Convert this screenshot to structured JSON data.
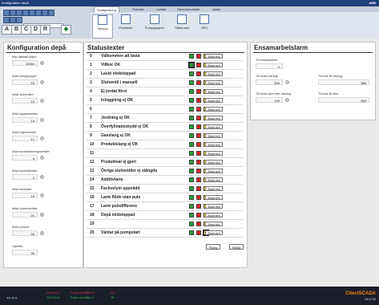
{
  "window": {
    "title": "Konfiguration depå",
    "brand_a": "Citect",
    "brand_b": "SCADA"
  },
  "toolbar": {
    "combo_value": "Bus",
    "letters": [
      "A",
      "B",
      "C",
      "D",
      "R"
    ]
  },
  "tabs": [
    "Konfigurering",
    "Översikt",
    "Loddar",
    "Huvudprodukter",
    "Adder"
  ],
  "ribbon_buttons": [
    "Service",
    "Produkter",
    "Pumpgrupper",
    "Tidkanaler",
    "VRU"
  ],
  "config": {
    "title": "Konfiguration depå",
    "fields": [
      {
        "label": "Max lastställ-volym:",
        "value": "10000"
      },
      {
        "label": "Antal pumpgrupper:",
        "value": "15"
      },
      {
        "label": "Antal slutventiler:",
        "value": "18"
      },
      {
        "label": "Antal bypassventiler:",
        "value": "14"
      },
      {
        "label": "Antal reglerventiler:",
        "value": "17"
      },
      {
        "label": "Antal tryckavlastningsventiler:",
        "value": "0"
      },
      {
        "label": "Antal tryckvisterster:",
        "value": "4"
      },
      {
        "label": "Antal trecrisare:",
        "value": "15"
      },
      {
        "label": "Antal ovlarmventiler:",
        "value": "20"
      },
      {
        "label": "Antal pumpar:",
        "value": "30"
      },
      {
        "label": "Cykeltid:",
        "value": "35"
      }
    ]
  },
  "status": {
    "title": "Statustexter",
    "edit_label": "Ändra text",
    "rows": [
      {
        "n": "0",
        "text": "Välkommen att lasta",
        "colors": [
          "g",
          "r",
          "y",
          "b"
        ],
        "sel": -1
      },
      {
        "n": "1",
        "text": "Villkor OK",
        "colors": [
          "g",
          "r",
          "y",
          "b"
        ],
        "sel": 0
      },
      {
        "n": "2",
        "text": "Lastö nödstoppad",
        "colors": [
          "g",
          "r",
          "y",
          "b"
        ],
        "sel": -1
      },
      {
        "n": "3",
        "text": "Slutventil i manuell",
        "colors": [
          "g",
          "r",
          "y",
          "b"
        ],
        "sel": -1
      },
      {
        "n": "4",
        "text": "Ej jordat först",
        "colors": [
          "g",
          "r",
          "y",
          "b"
        ],
        "sel": -1
      },
      {
        "n": "5",
        "text": "Inloggning ej OK",
        "colors": [
          "g",
          "r",
          "y",
          "b"
        ],
        "sel": -1
      },
      {
        "n": "6",
        "text": "",
        "colors": [
          "g",
          "r",
          "y",
          "b"
        ],
        "sel": -1
      },
      {
        "n": "7",
        "text": "Jordning ej OK",
        "colors": [
          "g",
          "r",
          "y",
          "b"
        ],
        "sel": -1
      },
      {
        "n": "8",
        "text": "Överfyllnadsskydd ej OK",
        "colors": [
          "g",
          "r",
          "y",
          "b"
        ],
        "sel": -1
      },
      {
        "n": "9",
        "text": "Gasslang ej OK",
        "colors": [
          "g",
          "r",
          "y",
          "b"
        ],
        "sel": -1
      },
      {
        "n": "10",
        "text": "Produktslang ej OK",
        "colors": [
          "g",
          "r",
          "y",
          "b"
        ],
        "sel": -1
      },
      {
        "n": "11",
        "text": "",
        "colors": [
          "g",
          "r",
          "y",
          "b"
        ],
        "sel": -1
      },
      {
        "n": "12",
        "text": "Produktval ej gjort",
        "colors": [
          "g",
          "r",
          "y",
          "b"
        ],
        "sel": -1
      },
      {
        "n": "13",
        "text": "Övriga slutventiler ej stängda",
        "colors": [
          "g",
          "r",
          "y",
          "b"
        ],
        "sel": -1
      },
      {
        "n": "14",
        "text": "Additivlarm",
        "colors": [
          "g",
          "r",
          "y",
          "b"
        ],
        "sel": -1
      },
      {
        "n": "15",
        "text": "Fackvolym uppnådd",
        "colors": [
          "g",
          "r",
          "y",
          "b"
        ],
        "sel": -1
      },
      {
        "n": "16",
        "text": "Larm flöde utan puls",
        "colors": [
          "g",
          "r",
          "y",
          "b"
        ],
        "sel": -1
      },
      {
        "n": "17",
        "text": "Larm pulsdifferens",
        "colors": [
          "g",
          "r",
          "y",
          "b"
        ],
        "sel": -1
      },
      {
        "n": "18",
        "text": "Depå nödstoppad",
        "colors": [
          "g",
          "r",
          "y",
          "b"
        ],
        "sel": -1
      },
      {
        "n": "19",
        "text": "",
        "colors": [
          "g",
          "r",
          "y",
          "b"
        ],
        "sel": -1
      },
      {
        "n": "20",
        "text": "Väntar på pumpstart",
        "colors": [
          "g",
          "r",
          "y",
          "b"
        ],
        "sel": 2
      }
    ],
    "btn_prev": "Föreg",
    "btn_next": "Nästa"
  },
  "ensam": {
    "title": "Ensamarbetslarm",
    "l1": "Tid ensamarbete:",
    "v1": "0",
    "l2": "Tid innan varning:",
    "v2": "600",
    "l3": "Tid kvar till varning:",
    "v3": "585",
    "l4": "Tid innan larm efter varning:",
    "v4": "120",
    "l5": "Tid kvar till larm:",
    "v5": "665"
  },
  "taskbar": {
    "alarms": [
      {
        "time": "2012-03-14",
        "desc": "Pump Larm Nåde 13",
        "state": "Ack"
      },
      {
        "time": "2012-03-14",
        "desc": "Pump Larm Nåde 13",
        "state": "Off"
      }
    ],
    "clock": "13:47:00"
  }
}
